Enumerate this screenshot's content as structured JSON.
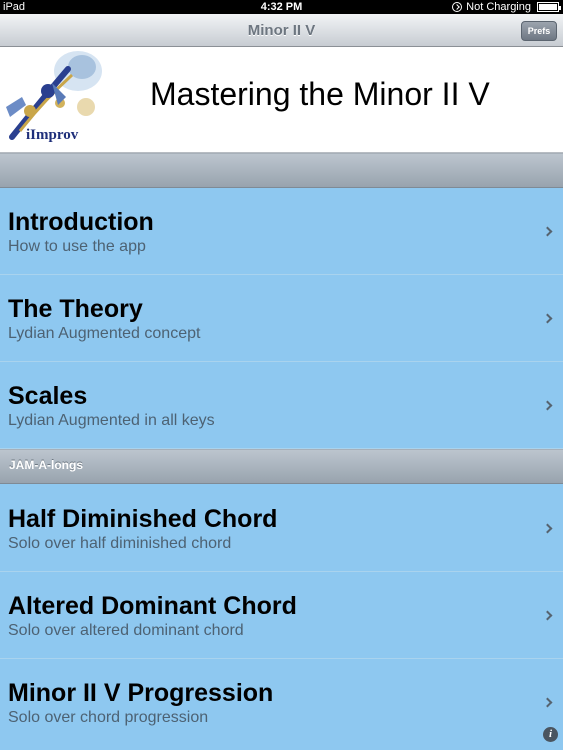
{
  "status_bar": {
    "carrier": "iPad",
    "time": "4:32 PM",
    "battery_status": "Not Charging"
  },
  "nav_bar": {
    "title": "Minor II V",
    "prefs_label": "Prefs"
  },
  "header": {
    "logo_text": "iImprov",
    "title": "Mastering the Minor II V"
  },
  "sections": [
    {
      "header": "",
      "rows": [
        {
          "title": "Introduction",
          "subtitle": "How to use the app"
        },
        {
          "title": "The Theory",
          "subtitle": "Lydian Augmented concept"
        },
        {
          "title": "Scales",
          "subtitle": "Lydian Augmented in all keys"
        }
      ]
    },
    {
      "header": "JAM-A-longs",
      "rows": [
        {
          "title": "Half Diminished Chord",
          "subtitle": "Solo over half diminished chord"
        },
        {
          "title": "Altered Dominant Chord",
          "subtitle": "Solo over altered dominant chord"
        },
        {
          "title": "Minor II V Progression",
          "subtitle": "Solo over chord progression"
        }
      ]
    }
  ],
  "icons": {
    "info": "info-icon",
    "chevron": "chevron-right-icon",
    "battery": "battery-icon",
    "orientation_lock": "orientation-lock-icon"
  },
  "colors": {
    "row_background": "#8ec8f0",
    "section_header": "#a7b1bb",
    "nav_bar": "#d9dde1"
  }
}
